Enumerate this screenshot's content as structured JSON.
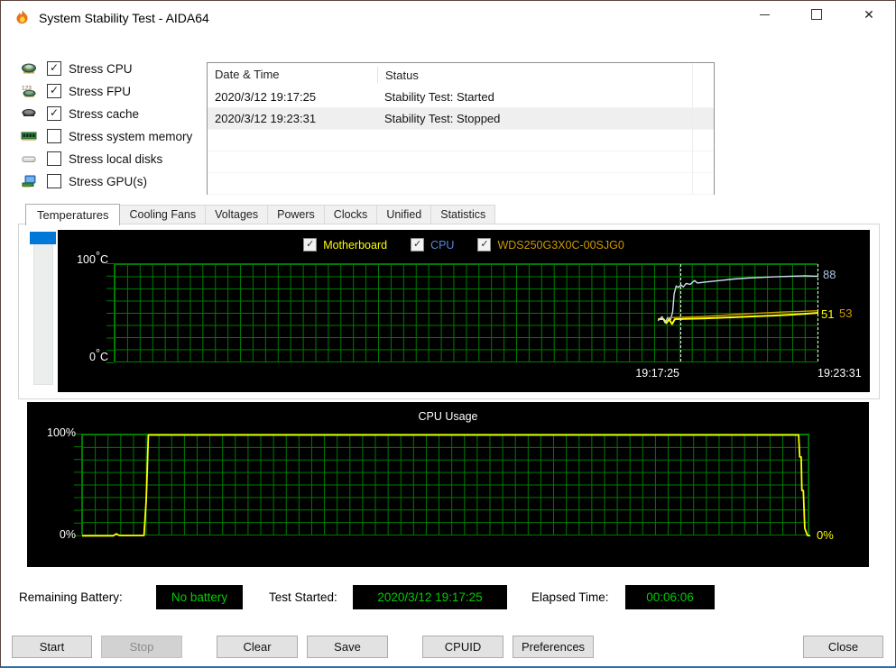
{
  "window": {
    "title": "System Stability Test - AIDA64",
    "accent_color": "#0078d7"
  },
  "stress_options": [
    {
      "icon": "cpu-icon",
      "label": "Stress CPU",
      "checked": true
    },
    {
      "icon": "fpu-icon",
      "label": "Stress FPU",
      "checked": true
    },
    {
      "icon": "cache-icon",
      "label": "Stress cache",
      "checked": true
    },
    {
      "icon": "memory-icon",
      "label": "Stress system memory",
      "checked": false
    },
    {
      "icon": "disk-icon",
      "label": "Stress local disks",
      "checked": false
    },
    {
      "icon": "gpu-icon",
      "label": "Stress GPU(s)",
      "checked": false
    }
  ],
  "log": {
    "columns": [
      "Date & Time",
      "Status"
    ],
    "rows": [
      [
        "2020/3/12 19:17:25",
        "Stability Test: Started"
      ],
      [
        "2020/3/12 19:23:31",
        "Stability Test: Stopped"
      ]
    ],
    "selected_index": 1,
    "empty_row_count": 3
  },
  "tabs": {
    "items": [
      "Temperatures",
      "Cooling Fans",
      "Voltages",
      "Powers",
      "Clocks",
      "Unified",
      "Statistics"
    ],
    "active_index": 0
  },
  "temp_chart": {
    "legend": [
      {
        "label": "Motherboard",
        "label_color": "#ffff00",
        "checked": true
      },
      {
        "label": "CPU",
        "label_color": "#5b85d6",
        "checked": true
      },
      {
        "label": "WDS250G3X0C-00SJG0",
        "label_color": "#cc9900",
        "checked": true
      }
    ],
    "y_max": "100",
    "y_min": "0",
    "deg": "°",
    "unit": "C",
    "grid_color": "#007c00"
  },
  "cpu_chart": {
    "title": "CPU Usage",
    "y_max": "100%",
    "y_min": "0%"
  },
  "status_bar": {
    "items": [
      {
        "label": "Remaining Battery:",
        "value": "No battery"
      },
      {
        "label": "Test Started:",
        "value": "2020/3/12 19:17:25"
      },
      {
        "label": "Elapsed Time:",
        "value": "00:06:06"
      }
    ],
    "value_color": "#00cd00"
  },
  "buttons": [
    {
      "label": "Start",
      "disabled": false
    },
    {
      "label": "Stop",
      "disabled": true
    },
    {
      "label": "Clear",
      "disabled": false
    },
    {
      "label": "Save",
      "disabled": false
    },
    {
      "label": "CPUID",
      "disabled": false
    },
    {
      "label": "Preferences",
      "disabled": false
    },
    {
      "label": "Close",
      "disabled": false
    }
  ],
  "chart_data": [
    {
      "type": "line",
      "title": "Temperatures",
      "ylabel": "°C",
      "ylim": [
        0,
        100
      ],
      "x_ticks": [
        "19:17:25",
        "19:23:31"
      ],
      "test_start_fraction": 0.804,
      "series": [
        {
          "name": "Motherboard",
          "color": "#ffff00",
          "width": 2,
          "end_label": "51",
          "points": [
            [
              0.772,
              44.5
            ],
            [
              0.78,
              44.5
            ],
            [
              0.784,
              40.5
            ],
            [
              0.788,
              44.3
            ],
            [
              0.792,
              39.5
            ],
            [
              0.796,
              44.5
            ],
            [
              0.804,
              44.6
            ],
            [
              0.815,
              44.9
            ],
            [
              0.835,
              45.3
            ],
            [
              0.86,
              45.9
            ],
            [
              0.885,
              46.6
            ],
            [
              0.91,
              47.4
            ],
            [
              0.935,
              48.1
            ],
            [
              0.96,
              49.0
            ],
            [
              0.98,
              49.9
            ],
            [
              1.0,
              50.9
            ]
          ]
        },
        {
          "name": "CPU",
          "color": "#cfdcf2",
          "width": 1.4,
          "end_label": "88",
          "points": [
            [
              0.772,
              43
            ],
            [
              0.778,
              47
            ],
            [
              0.782,
              41
            ],
            [
              0.786,
              46
            ],
            [
              0.79,
              44
            ],
            [
              0.793,
              52
            ],
            [
              0.795,
              70
            ],
            [
              0.798,
              78
            ],
            [
              0.801,
              76.5
            ],
            [
              0.805,
              79
            ],
            [
              0.808,
              77
            ],
            [
              0.812,
              80.5
            ],
            [
              0.818,
              79.5
            ],
            [
              0.824,
              83.5
            ],
            [
              0.828,
              81
            ],
            [
              0.84,
              82
            ],
            [
              0.86,
              83.5
            ],
            [
              0.88,
              85
            ],
            [
              0.9,
              86
            ],
            [
              0.93,
              87
            ],
            [
              0.96,
              87.8
            ],
            [
              0.98,
              88.2
            ],
            [
              1.0,
              87.8
            ]
          ]
        },
        {
          "name": "WDS250G3X0C-00SJG0",
          "color": "#cc9900",
          "width": 1.4,
          "end_label": "53",
          "points": [
            [
              0.786,
              46
            ],
            [
              0.8,
              46.3
            ],
            [
              0.83,
              47
            ],
            [
              0.86,
              48.2
            ],
            [
              0.89,
              49.5
            ],
            [
              0.92,
              50.7
            ],
            [
              0.95,
              51.7
            ],
            [
              0.975,
              52.4
            ],
            [
              1.0,
              53
            ]
          ]
        }
      ]
    },
    {
      "type": "line",
      "title": "CPU Usage",
      "ylabel": "%",
      "ylim": [
        0,
        100
      ],
      "series": [
        {
          "name": "CPU Usage",
          "color": "#ffff00",
          "width": 1.8,
          "end_label": "0%",
          "points": [
            [
              0,
              0.6
            ],
            [
              0.043,
              0.6
            ],
            [
              0.047,
              2.6
            ],
            [
              0.051,
              0.9
            ],
            [
              0.085,
              0.9
            ],
            [
              0.088,
              35
            ],
            [
              0.0895,
              65
            ],
            [
              0.091,
              99.6
            ],
            [
              0.984,
              99.6
            ],
            [
              0.9855,
              78
            ],
            [
              0.9875,
              78
            ],
            [
              0.9885,
              45
            ],
            [
              0.9905,
              45
            ],
            [
              0.9925,
              8
            ],
            [
              0.996,
              1
            ],
            [
              1.0,
              0.6
            ]
          ]
        }
      ]
    }
  ]
}
